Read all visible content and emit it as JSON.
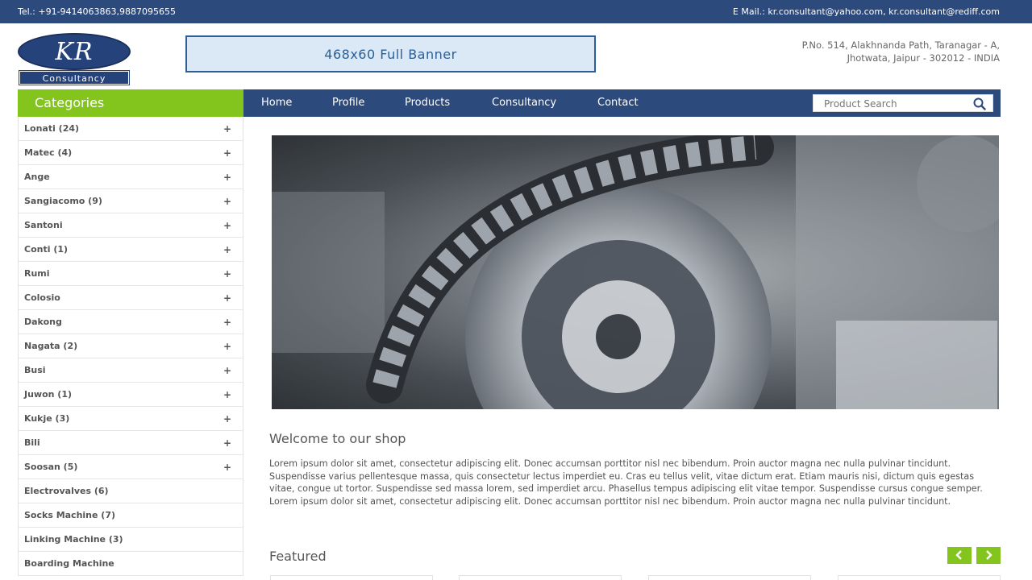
{
  "topbar": {
    "tel": "Tel.: +91-9414063863,9887095655",
    "mail": "E Mail.: kr.consultant@yahoo.com, kr.consultant@rediff.com"
  },
  "logo": {
    "mark": "KR",
    "sub": "Consultancy"
  },
  "banner": {
    "text": "468x60 Full Banner"
  },
  "address": {
    "line1": "P.No. 514, Alakhnanda Path, Taranagar - A,",
    "line2": "Jhotwata, Jaipur - 302012 - INDIA"
  },
  "categories": {
    "title": "Categories",
    "items": [
      {
        "label": "Lonati (24)",
        "plus": "+"
      },
      {
        "label": "Matec (4)",
        "plus": "+"
      },
      {
        "label": "Ange",
        "plus": "+"
      },
      {
        "label": "Sangiacomo (9)",
        "plus": "+"
      },
      {
        "label": "Santoni",
        "plus": "+"
      },
      {
        "label": "Conti (1)",
        "plus": "+"
      },
      {
        "label": "Rumi",
        "plus": "+"
      },
      {
        "label": "Colosio",
        "plus": "+"
      },
      {
        "label": "Dakong",
        "plus": "+"
      },
      {
        "label": "Nagata (2)",
        "plus": "+"
      },
      {
        "label": "Busi",
        "plus": "+"
      },
      {
        "label": "Juwon (1)",
        "plus": "+"
      },
      {
        "label": "Kukje (3)",
        "plus": "+"
      },
      {
        "label": "Bili",
        "plus": "+"
      },
      {
        "label": "Soosan (5)",
        "plus": "+"
      },
      {
        "label": "Electrovalves (6)",
        "plus": ""
      },
      {
        "label": "Socks Machine (7)",
        "plus": ""
      },
      {
        "label": "Linking Machine (3)",
        "plus": ""
      },
      {
        "label": "Boarding Machine",
        "plus": ""
      }
    ]
  },
  "nav": {
    "items": [
      "Home",
      "Profile",
      "Products",
      "Consultancy",
      "Contact"
    ],
    "search_placeholder": "Product Search"
  },
  "main": {
    "welcome_title": "Welcome to our shop",
    "welcome_text": "Lorem ipsum dolor sit amet, consectetur adipiscing elit. Donec accumsan porttitor nisl nec bibendum. Proin auctor magna nec nulla pulvinar tincidunt. Suspendisse varius pellentesque massa, quis consectetur lectus imperdiet eu. Cras eu tellus velit, vitae dictum erat. Etiam mauris nisi, dictum quis egestas vitae, congue ut tortor. Suspendisse sed massa lorem, sed imperdiet arcu. Phasellus tempus adipiscing elit vitae tempor. Suspendisse cursus congue semper. Lorem ipsum dolor sit amet, consectetur adipiscing elit. Donec accumsan porttitor nisl nec bibendum. Proin auctor magna nec nulla pulvinar tincidunt.",
    "featured_title": "Featured"
  },
  "colors": {
    "navy": "#2d4a7d",
    "green": "#83c51d"
  },
  "icons": [
    "search-icon",
    "chevron-left-icon",
    "chevron-right-icon",
    "plus-icon"
  ]
}
